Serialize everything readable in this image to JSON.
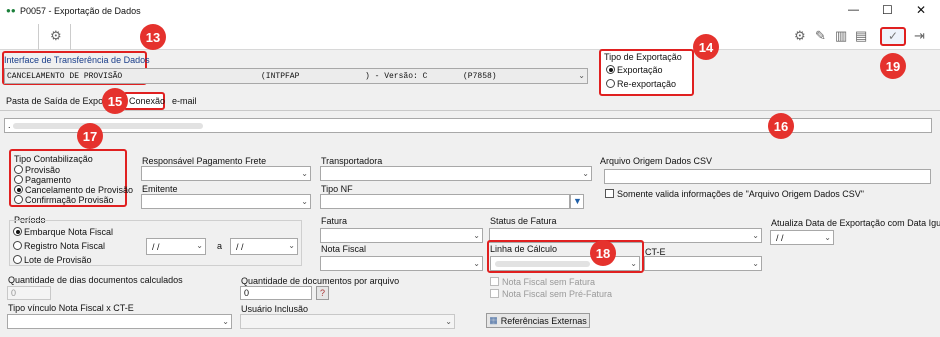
{
  "window": {
    "title": "P0057 - Exportação de Dados",
    "dots_icon": "app-dots-icon"
  },
  "window_controls": {
    "minimize": "—",
    "maximize": "☐",
    "close": "✕"
  },
  "interface": {
    "label": "Interface de Transferência de Dados",
    "selected": "CANCELAMENTO DE PROVISÃO",
    "code": "(INTPFAP",
    "version_text": ") - Versão: C",
    "program": "(P7858)"
  },
  "tipo_exportacao": {
    "legend": "Tipo de Exportação",
    "options": [
      "Exportação",
      "Re-exportação"
    ],
    "selected": 0
  },
  "tabs": [
    "Pasta de Saída de Exportação",
    "Conexão",
    "e-mail"
  ],
  "path_value": ".",
  "tipo_contabilizacao": {
    "legend": "Tipo Contabilização",
    "options": [
      "Provisão",
      "Pagamento",
      "Cancelamento de Provisão",
      "Confirmação Provisão"
    ],
    "selected": 2
  },
  "fields": {
    "responsavel": "Responsável Pagamento Frete",
    "transportadora": "Transportadora",
    "arquivo_origem": "Arquivo Origem Dados CSV",
    "emitente": "Emitente",
    "tipo_nf": "Tipo NF",
    "somente_valida": "Somente valida informações de \"Arquivo Origem Dados CSV\"",
    "fatura": "Fatura",
    "status_fatura": "Status de Fatura",
    "atualiza_data": "Atualiza Data de Exportação com Data Igual a",
    "nota_fiscal": "Nota Fiscal",
    "linha_calculo": "Linha de Cálculo",
    "cte": "CT-E",
    "nf_sem_fatura": "Nota Fiscal sem Fatura",
    "nf_sem_prefatura": "Nota Fiscal sem Pré-Fatura",
    "qtd_dias": "Quantidade de dias documentos calculados",
    "qtd_dias_value": "0",
    "qtd_docs": "Quantidade de documentos por arquivo",
    "qtd_docs_value": "0",
    "help_label": "?",
    "tipo_vinculo": "Tipo vínculo Nota Fiscal x CT-E",
    "usuario_inclusao": "Usuário Inclusão",
    "referencias_btn": "Referências Externas"
  },
  "periodo": {
    "legend": "Período",
    "options": [
      "Embarque Nota Fiscal",
      "Registro Nota Fiscal",
      "Lote de Provisão"
    ],
    "selected": 0,
    "date_from": "/ /",
    "sep": "a",
    "date_to": "/ /"
  },
  "atualiza_date_value": "/ /",
  "badges": [
    "13",
    "14",
    "15",
    "16",
    "17",
    "18",
    "19"
  ],
  "colors": {
    "badge": "#e5322d",
    "highlight": "#e02020"
  }
}
